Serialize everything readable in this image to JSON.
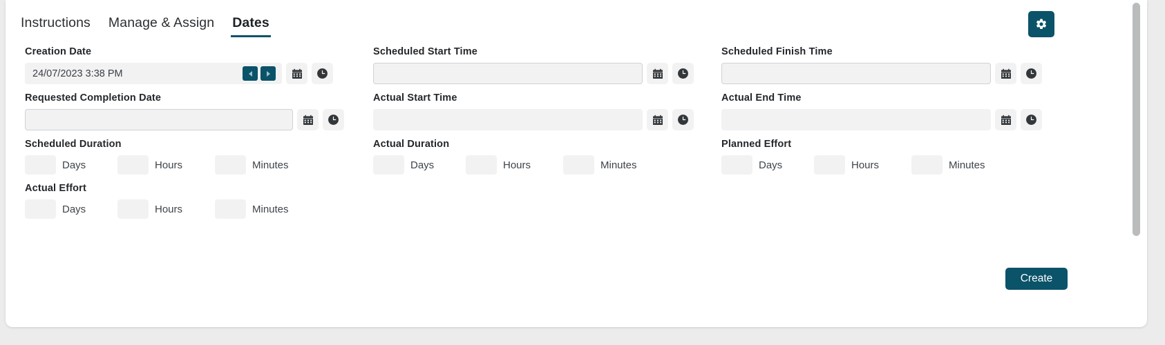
{
  "colors": {
    "accent": "#0b5369",
    "page_bg": "#ececed",
    "card_bg": "#ffffff",
    "input_bg": "#f2f2f3",
    "input_border": "#cfd2d4",
    "label": "#23272b",
    "scrollbar": "#b9bbbd"
  },
  "tabs": [
    {
      "label": "Instructions",
      "active": false
    },
    {
      "label": "Manage & Assign",
      "active": false
    },
    {
      "label": "Dates",
      "active": true
    }
  ],
  "header": {
    "settings_button": {
      "icon": "gear-icon",
      "label": ""
    }
  },
  "icons": {
    "calendar": "calendar-icon",
    "clock": "clock-icon",
    "spinner_prev": "chevron-left-icon",
    "spinner_next": "chevron-right-icon",
    "gear": "gear-icon"
  },
  "fields": {
    "creation_date": {
      "label": "Creation Date",
      "value": "24/07/2023 3:38 PM",
      "placeholder": "",
      "has_spinners": true,
      "calendar_button": "calendar-icon",
      "clock_button": "clock-icon"
    },
    "scheduled_start_time": {
      "label": "Scheduled Start Time",
      "value": "",
      "placeholder": "",
      "calendar_button": "calendar-icon",
      "clock_button": "clock-icon"
    },
    "scheduled_finish_time": {
      "label": "Scheduled Finish Time",
      "value": "",
      "placeholder": "",
      "calendar_button": "calendar-icon",
      "clock_button": "clock-icon"
    },
    "requested_completion_date": {
      "label": "Requested Completion Date",
      "value": "",
      "placeholder": "",
      "calendar_button": "calendar-icon",
      "clock_button": "clock-icon"
    },
    "actual_start_time": {
      "label": "Actual Start Time",
      "value": "",
      "placeholder": "",
      "calendar_button": "calendar-icon",
      "clock_button": "clock-icon"
    },
    "actual_end_time": {
      "label": "Actual End Time",
      "value": "",
      "placeholder": "",
      "calendar_button": "calendar-icon",
      "clock_button": "clock-icon"
    }
  },
  "durations": {
    "scheduled_duration": {
      "label": "Scheduled Duration",
      "days": {
        "label": "Days",
        "value": ""
      },
      "hours": {
        "label": "Hours",
        "value": ""
      },
      "minutes": {
        "label": "Minutes",
        "value": ""
      }
    },
    "actual_duration": {
      "label": "Actual Duration",
      "days": {
        "label": "Days",
        "value": ""
      },
      "hours": {
        "label": "Hours",
        "value": ""
      },
      "minutes": {
        "label": "Minutes",
        "value": ""
      }
    },
    "planned_effort": {
      "label": "Planned Effort",
      "days": {
        "label": "Days",
        "value": ""
      },
      "hours": {
        "label": "Hours",
        "value": ""
      },
      "minutes": {
        "label": "Minutes",
        "value": ""
      }
    },
    "actual_effort": {
      "label": "Actual Effort",
      "days": {
        "label": "Days",
        "value": ""
      },
      "hours": {
        "label": "Hours",
        "value": ""
      },
      "minutes": {
        "label": "Minutes",
        "value": ""
      }
    }
  },
  "footer": {
    "create_label": "Create"
  }
}
